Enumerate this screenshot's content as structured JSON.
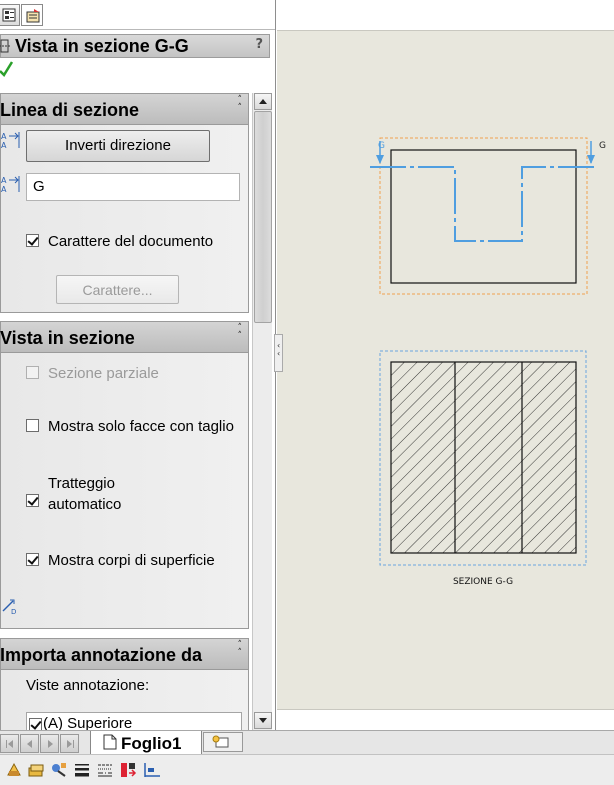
{
  "property_manager": {
    "title": "Vista in sezione G-G",
    "help": "?",
    "tabs": [
      {
        "icon": "feature-manager-tab-icon"
      },
      {
        "icon": "property-manager-tab-icon"
      }
    ]
  },
  "section_line": {
    "header": "Linea di sezione",
    "flip_button": "Inverti direzione",
    "label_value": "G",
    "doc_font_label": "Carattere del documento",
    "doc_font_checked": true,
    "font_button": "Carattere..."
  },
  "section_view": {
    "header": "Vista in sezione",
    "partial_label": "Sezione parziale",
    "partial_checked": false,
    "cut_faces_label": "Mostra solo facce con taglio",
    "cut_faces_checked": false,
    "auto_hatch_line1": "Tratteggio",
    "auto_hatch_line2": "automatico",
    "auto_hatch_checked": true,
    "surface_bodies_label": "Mostra corpi di superficie",
    "surface_bodies_checked": true
  },
  "import_annotations": {
    "header": "Importa annotazione da",
    "views_label": "Viste annotazione:",
    "first_item": "(A) Superiore",
    "first_item_checked": true
  },
  "drawing": {
    "section_label_left": "G",
    "section_label_right": "G",
    "view_caption": "SEZIONE G-G",
    "colors": {
      "sheet": "#e8e7dd",
      "section_line": "#4f9ee0",
      "parent_view_border": "#f0a050",
      "section_view_border": "#6aa6e0"
    }
  },
  "sheet_tabs": {
    "active": "Foglio1"
  },
  "toolbar_icons": [
    "rebuild-icon",
    "layers-icon",
    "properties-icon",
    "line-weight-icon",
    "line-style-icon",
    "color-icon",
    "dimension-icon"
  ]
}
